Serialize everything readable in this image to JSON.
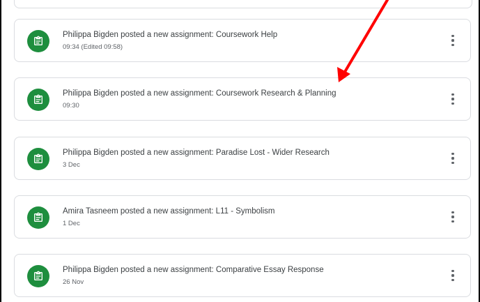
{
  "stream": {
    "posts": [
      {
        "title": "Philippa Bigden posted a new assignment: Coursework Help",
        "time": "09:34 (Edited 09:58)",
        "icon": "assignment-icon"
      },
      {
        "title": "Philippa Bigden posted a new assignment: Coursework Research & Planning",
        "time": "09:30",
        "icon": "assignment-icon"
      },
      {
        "title": "Philippa Bigden posted a new assignment: Paradise Lost - Wider Research",
        "time": "3 Dec",
        "icon": "assignment-icon"
      },
      {
        "title": "Amira Tasneem posted a new assignment: L11 - Symbolism",
        "time": "1 Dec",
        "icon": "assignment-icon"
      },
      {
        "title": "Philippa Bigden posted a new assignment: Comparative Essay Response",
        "time": "26 Nov",
        "icon": "assignment-icon"
      }
    ]
  },
  "colors": {
    "accent_green": "#1e8e3e",
    "annotation_arrow": "#ff0000",
    "border": "#dadce0"
  }
}
